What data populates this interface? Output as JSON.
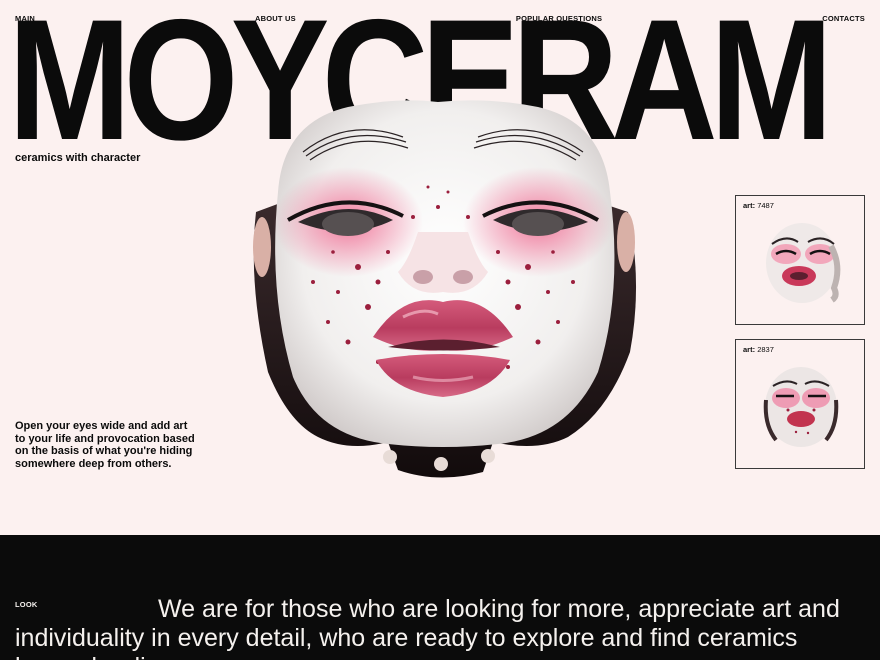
{
  "nav": {
    "main": "MAIN",
    "about": "ABOUT US",
    "questions": "POPULAR QUESTIONS",
    "contacts": "CONTACTS"
  },
  "brand": "MOYCERAM",
  "tagline": "ceramics with character",
  "hero_copy": "Open your eyes wide and add art to your life and provocation based on the basis of what you're hiding somewhere deep from others.",
  "gallery": [
    {
      "label_prefix": "art:",
      "number": "7487"
    },
    {
      "label_prefix": "art:",
      "number": "2837"
    }
  ],
  "section": {
    "look": "LOOK",
    "statement": "We are for those who are looking for more, appreciate art and individuality in every detail, who are ready to explore and find ceramics beyond ordinary"
  },
  "colors": {
    "background": "#fcf1f0",
    "text": "#0b0b0b",
    "dark_section": "#0b0b0b",
    "blush": "#f06b92",
    "lips": "#c9476a"
  },
  "hero_image": "ceramic-face-sculpture"
}
